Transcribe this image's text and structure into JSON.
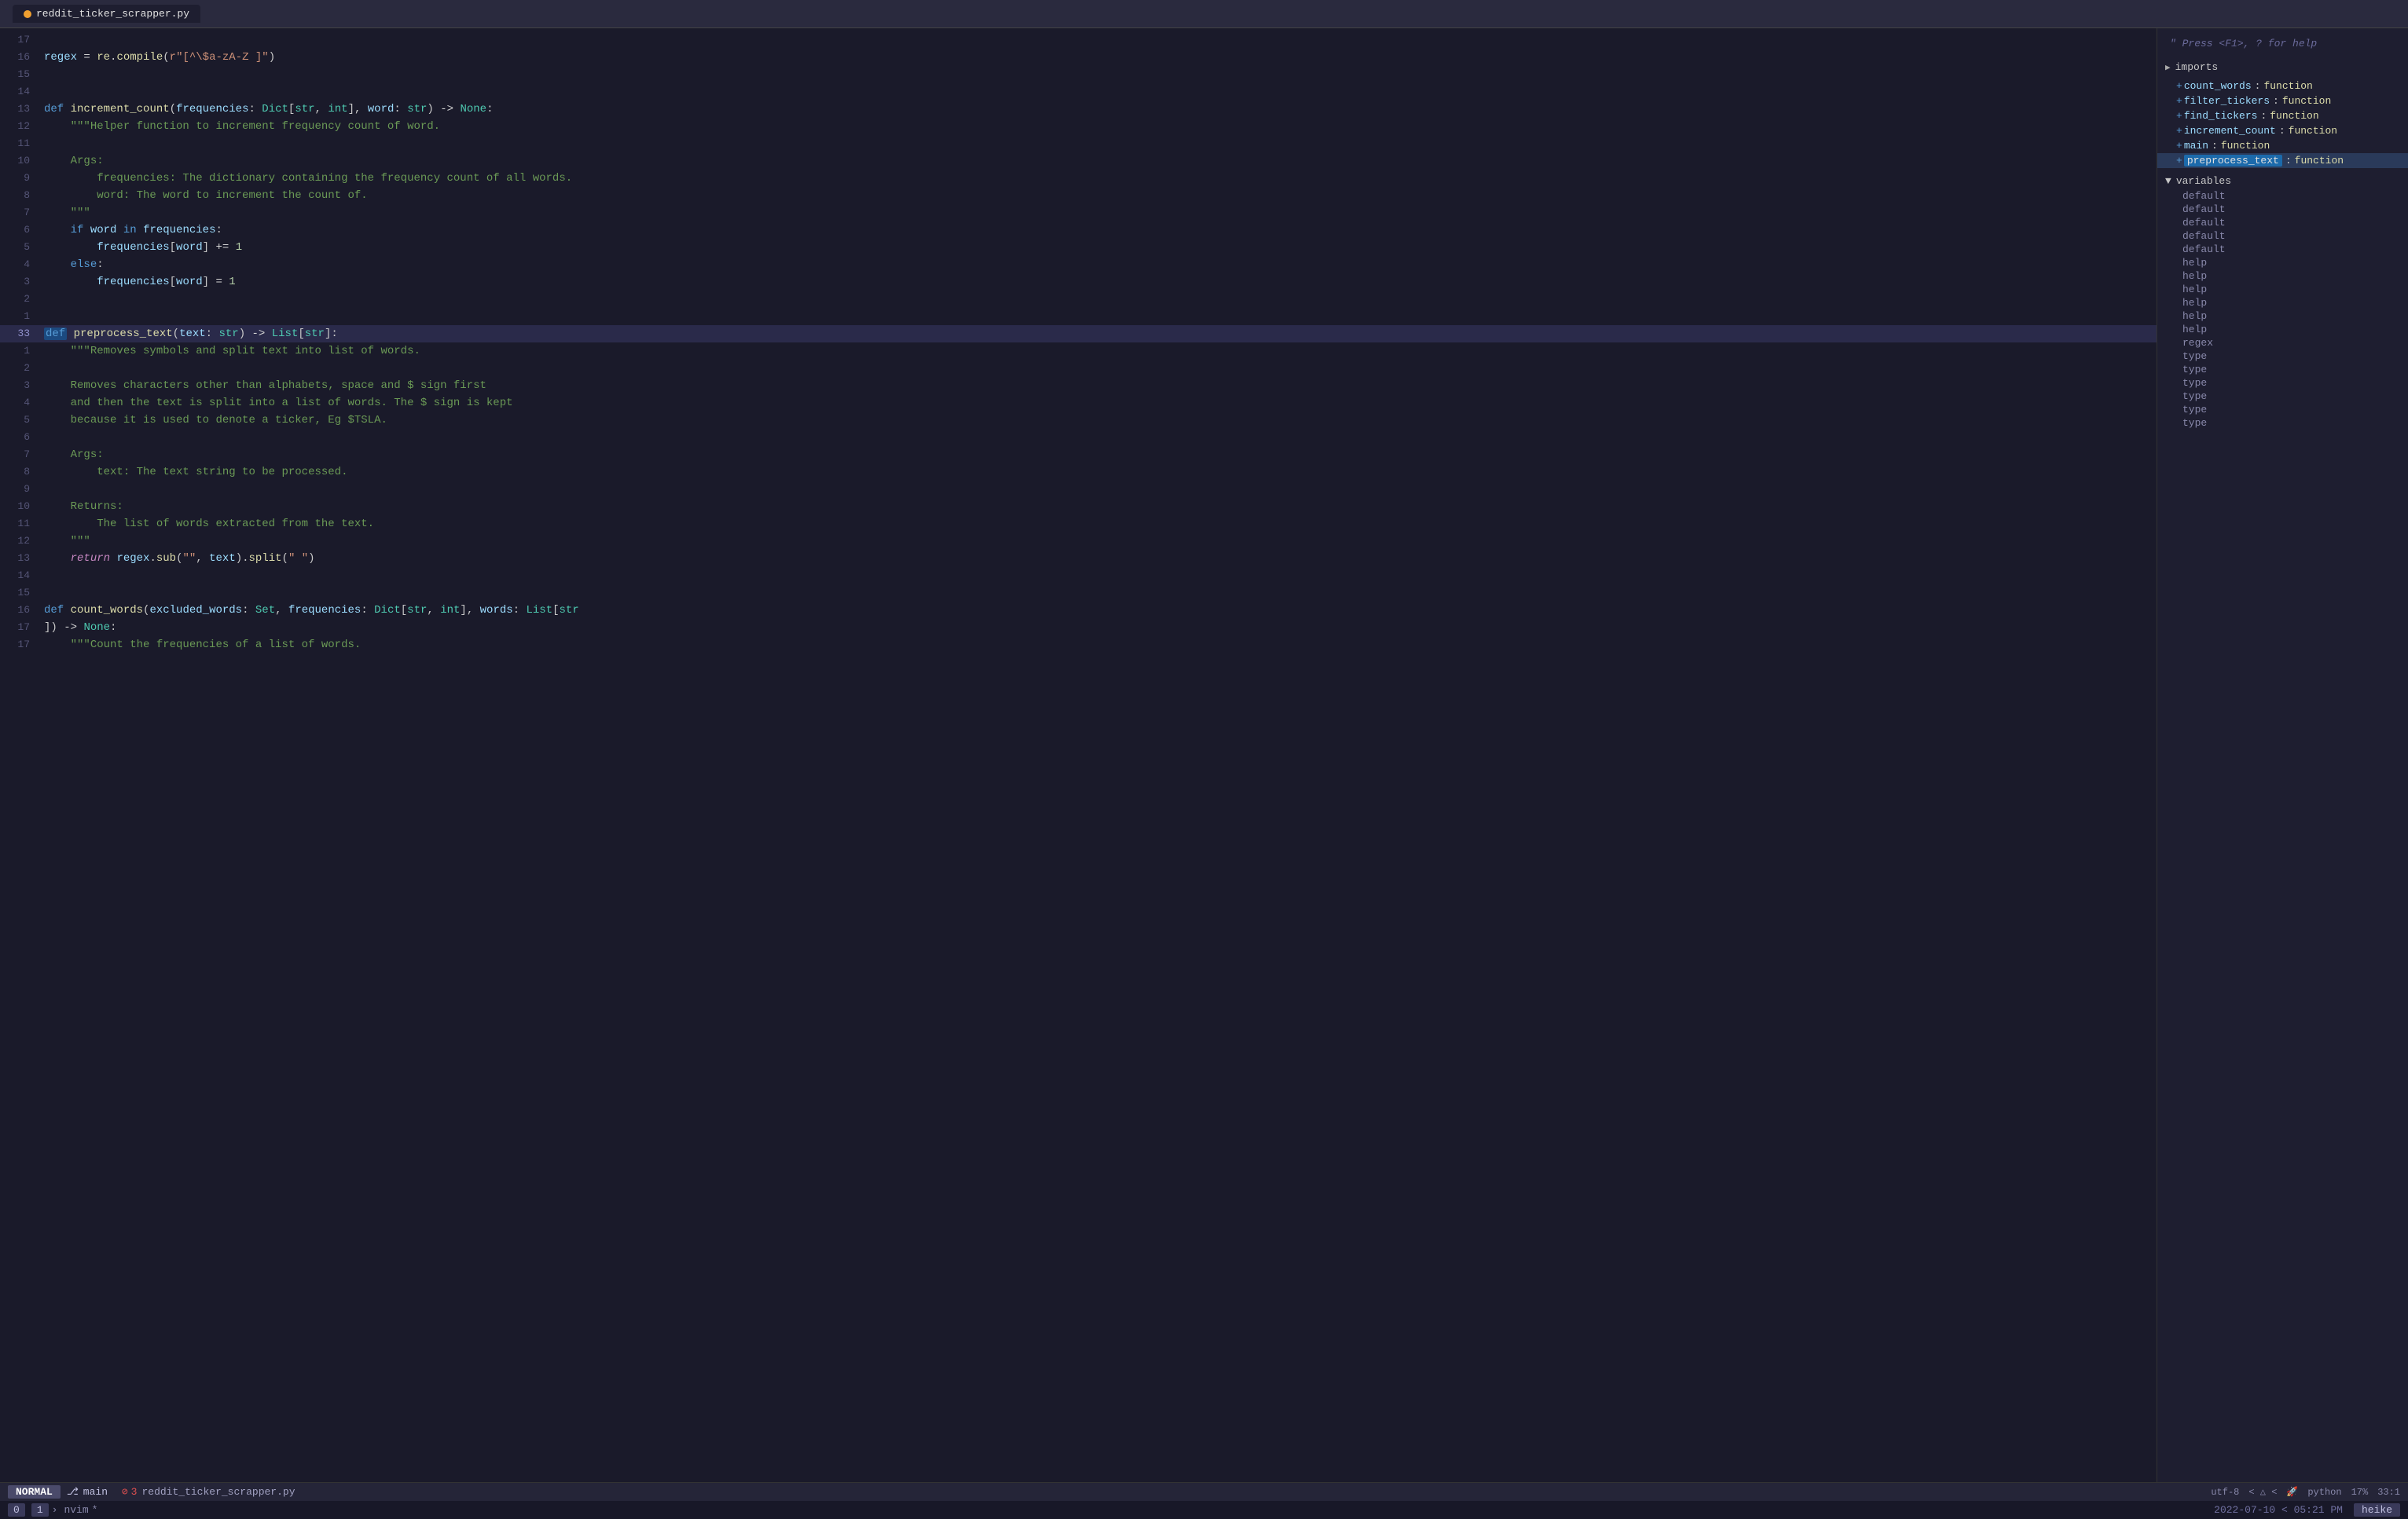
{
  "title_bar": {
    "tab_label": "reddit_ticker_scrapper.py",
    "tab_icon": "●"
  },
  "status_bar": {
    "mode": "NORMAL",
    "branch_icon": "⎇",
    "branch": "main",
    "error_icon": "⊘",
    "error_count": "3",
    "file": "reddit_ticker_scrapper.py",
    "encoding": "utf-8",
    "format_icons": "< △ <",
    "lang": "python",
    "percent": "17%",
    "cursor": "33:1"
  },
  "bottom_bar": {
    "tab0": "0",
    "tab1": "1",
    "app": "nvim",
    "modified": "*",
    "datetime": "2022-07-10 < 05:21 PM",
    "user": "heike"
  },
  "sidebar": {
    "hint": "\" Press <F1>, ? for help",
    "imports_label": "imports",
    "functions": [
      {
        "name": "count_words",
        "type": "function",
        "selected": false
      },
      {
        "name": "filter_tickers",
        "type": "function",
        "selected": false
      },
      {
        "name": "find_tickers",
        "type": "function",
        "selected": false
      },
      {
        "name": "increment_count",
        "type": "function",
        "selected": false
      },
      {
        "name": "main",
        "type": "function",
        "selected": false
      },
      {
        "name": "preprocess_text",
        "type": "function",
        "selected": true
      }
    ],
    "variables_label": "variables",
    "variables": [
      "default",
      "default",
      "default",
      "default",
      "default",
      "help",
      "help",
      "help",
      "help",
      "help",
      "help",
      "regex",
      "type",
      "type",
      "type",
      "type",
      "type",
      "type"
    ]
  },
  "code": {
    "lines": [
      {
        "num": "17",
        "content": ""
      },
      {
        "num": "16",
        "content": "regex = re.compile(r\"[^\\$a-zA-Z ]\")"
      },
      {
        "num": "15",
        "content": ""
      },
      {
        "num": "14",
        "content": ""
      },
      {
        "num": "13",
        "content": "def increment_count(frequencies: Dict[str, int], word: str) -> None:"
      },
      {
        "num": "12",
        "content": "    \"\"\"Helper function to increment frequency count of word."
      },
      {
        "num": "11",
        "content": ""
      },
      {
        "num": "10",
        "content": "    Args:"
      },
      {
        "num": "9",
        "content": "        frequencies: The dictionary containing the frequency count of all words."
      },
      {
        "num": "8",
        "content": "        word: The word to increment the count of."
      },
      {
        "num": "7",
        "content": "    \"\"\""
      },
      {
        "num": "6",
        "content": "    if word in frequencies:"
      },
      {
        "num": "5",
        "content": "        frequencies[word] += 1"
      },
      {
        "num": "4",
        "content": "    else:"
      },
      {
        "num": "3",
        "content": "        frequencies[word] = 1"
      },
      {
        "num": "2",
        "content": ""
      },
      {
        "num": "1",
        "content": ""
      },
      {
        "num": "33",
        "content": "def preprocess_text(text: str) -> List[str]:",
        "current": true
      },
      {
        "num": "1",
        "content": "    \"\"\"Removes symbols and split text into list of words."
      },
      {
        "num": "2",
        "content": ""
      },
      {
        "num": "3",
        "content": "    Removes characters other than alphabets, space and $ sign first"
      },
      {
        "num": "4",
        "content": "    and then the text is split into a list of words. The $ sign is kept"
      },
      {
        "num": "5",
        "content": "    because it is used to denote a ticker, Eg $TSLA."
      },
      {
        "num": "6",
        "content": ""
      },
      {
        "num": "7",
        "content": "    Args:"
      },
      {
        "num": "8",
        "content": "        text: The text string to be processed."
      },
      {
        "num": "9",
        "content": ""
      },
      {
        "num": "10",
        "content": "    Returns:"
      },
      {
        "num": "11",
        "content": "        The list of words extracted from the text."
      },
      {
        "num": "12",
        "content": "    \"\"\""
      },
      {
        "num": "13",
        "content": "    return regex.sub(\"\", text).split(\" \")"
      },
      {
        "num": "14",
        "content": ""
      },
      {
        "num": "15",
        "content": ""
      },
      {
        "num": "16",
        "content": "def count_words(excluded_words: Set, frequencies: Dict[str, int], words: List[str"
      },
      {
        "num": "17",
        "content": "]) -> None:"
      },
      {
        "num": "17",
        "content": "    \"\"\"Count the frequencies of a list of words."
      }
    ]
  }
}
